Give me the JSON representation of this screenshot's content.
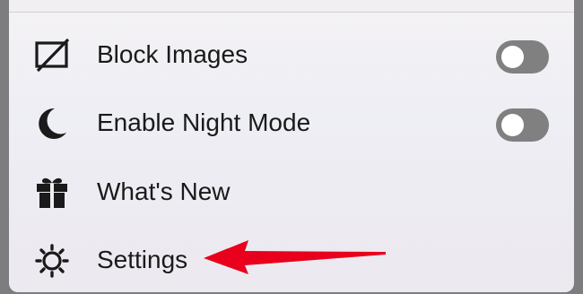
{
  "menu": {
    "items": [
      {
        "label": "Block Images",
        "icon": "image-off-icon",
        "toggle": {
          "on": false
        }
      },
      {
        "label": "Enable Night Mode",
        "icon": "moon-icon",
        "toggle": {
          "on": false
        }
      },
      {
        "label": "What's New",
        "icon": "gift-icon"
      },
      {
        "label": "Settings",
        "icon": "gear-icon"
      }
    ]
  },
  "colors": {
    "toggle_off": "#808080",
    "arrow": "#e8001c",
    "text": "#1a1a1a"
  }
}
